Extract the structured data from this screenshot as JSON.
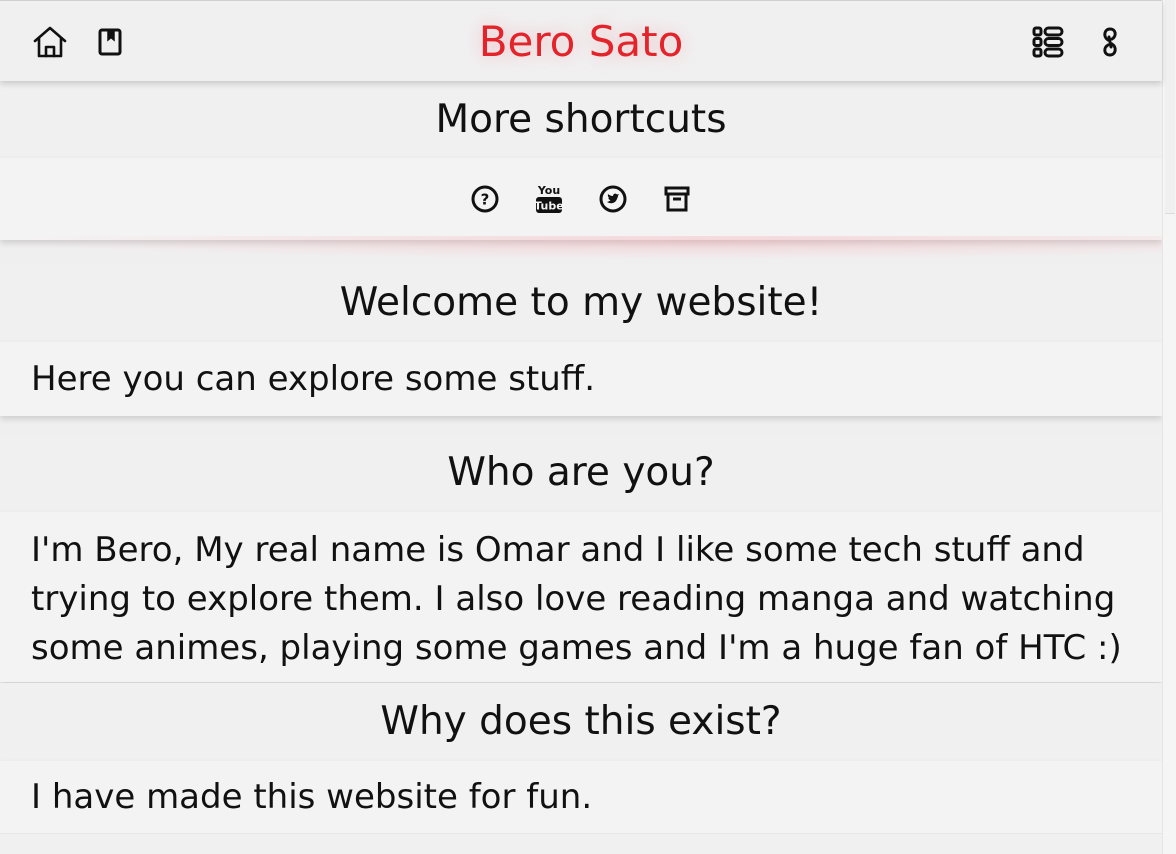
{
  "header": {
    "title": "Bero Sato",
    "left_icons": [
      "home-icon",
      "bookmark-icon"
    ],
    "right_icons": [
      "list-icon",
      "link-icon"
    ],
    "title_color": "#e3242b"
  },
  "shortcuts": {
    "heading": "More shortcuts",
    "icons": [
      "help-circle-icon",
      "youtube-icon",
      "twitter-circle-icon",
      "archive-icon"
    ]
  },
  "sections": {
    "welcome": {
      "heading": "Welcome to my website!",
      "body": "Here you can explore some stuff."
    },
    "who": {
      "heading": "Who are you?",
      "line1": "I'm Bero, My real name is Omar and I like some tech stuff and",
      "line2": "trying to explore them. I also love reading manga and watching",
      "line3": "some animes, playing some games and I'm a huge fan of HTC :)"
    },
    "why": {
      "heading": "Why does this exist?",
      "body": "I have made this website for fun."
    }
  }
}
